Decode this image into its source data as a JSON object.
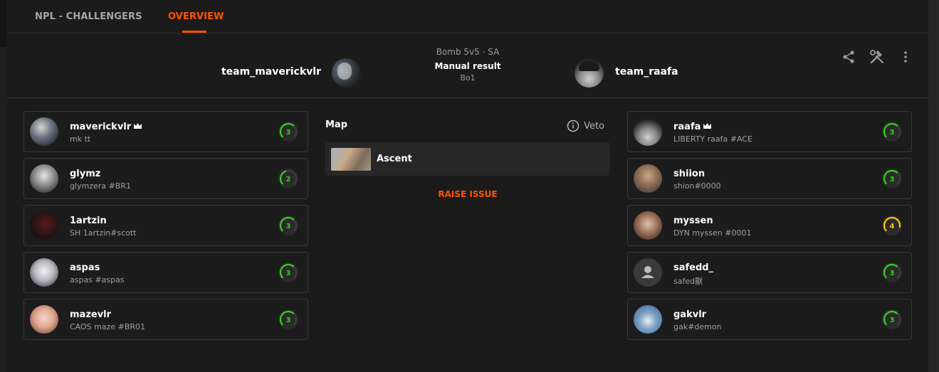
{
  "tabs": [
    {
      "label": "NPL - CHALLENGERS",
      "active": false
    },
    {
      "label": "OVERVIEW",
      "active": true
    }
  ],
  "accent_color": "#ff5500",
  "match": {
    "mode": "Bomb 5v5 · SA",
    "result": "Manual result",
    "format": "Bo1",
    "team_left": "team_maverickvlr",
    "team_right": "team_raafa"
  },
  "header_icons": [
    "share-icon",
    "tools-icon",
    "more-vertical-icon"
  ],
  "map_section": {
    "title": "Map",
    "veto_label": "Veto",
    "map_name": "Ascent",
    "raise_issue": "RAISE ISSUE"
  },
  "left_players": [
    {
      "name": "maverickvlr",
      "sub": "mk tt",
      "level": "3",
      "leader": true,
      "level_color": "#32d11d",
      "level_fraction": 0.3
    },
    {
      "name": "glymz",
      "sub": "glymzera #BR1",
      "level": "2",
      "leader": false,
      "level_color": "#32d11d",
      "level_fraction": 0.2
    },
    {
      "name": "1artzin",
      "sub": "SH 1artzin#scott",
      "level": "3",
      "leader": false,
      "level_color": "#32d11d",
      "level_fraction": 0.3
    },
    {
      "name": "aspas",
      "sub": "aspas #aspas",
      "level": "3",
      "leader": false,
      "level_color": "#32d11d",
      "level_fraction": 0.3
    },
    {
      "name": "mazevlr",
      "sub": "CAOS maze #BR01",
      "level": "3",
      "leader": false,
      "level_color": "#32d11d",
      "level_fraction": 0.3
    }
  ],
  "right_players": [
    {
      "name": "raafa",
      "sub": "LIBERTY raafa #ACE",
      "level": "3",
      "leader": true,
      "level_color": "#32d11d",
      "level_fraction": 0.3
    },
    {
      "name": "shiion",
      "sub": "shion#0000",
      "level": "3",
      "leader": false,
      "level_color": "#32d11d",
      "level_fraction": 0.3
    },
    {
      "name": "myssen",
      "sub": "DYN myssen #0001",
      "level": "4",
      "leader": false,
      "level_color": "#ffc800",
      "level_fraction": 0.4
    },
    {
      "name": "safedd_",
      "sub": "safed獸",
      "level": "3",
      "leader": false,
      "level_color": "#32d11d",
      "level_fraction": 0.3
    },
    {
      "name": "gakvlr",
      "sub": "gak#demon",
      "level": "3",
      "leader": false,
      "level_color": "#32d11d",
      "level_fraction": 0.3
    }
  ]
}
